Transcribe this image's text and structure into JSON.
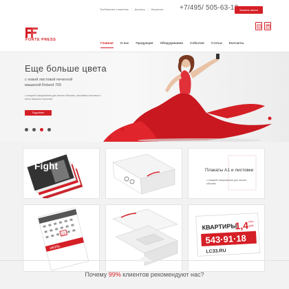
{
  "topbar": {
    "links": [
      "Требования к макетам",
      "Договор",
      "Вакансии"
    ],
    "phone": "+7/495/ 505-63-13",
    "callback_label": "Заказать звонок"
  },
  "brand": {
    "name": "FORTE PRESS",
    "accent_color": "#d51f26"
  },
  "header_icons": [
    "document-icon",
    "calculator-icon"
  ],
  "nav": {
    "items": [
      "Главная",
      "О нас",
      "Продукция",
      "Оборудование",
      "События",
      "Статьи",
      "Контакты"
    ],
    "active_index": 0
  },
  "hero": {
    "title": "Еще больше цвета",
    "subtitle": "с новой листовой печатной машиной Roland 705",
    "small_text": "с секцией лакирования для печати обложек, рекламных вставок и всего высшего качества",
    "button_label": "Подробнее",
    "slide_count": 4,
    "active_slide": 2
  },
  "tiles": {
    "featured_title": "Плакаты А1 и листовки",
    "featured_desc": "с секцией лакирования для печати обложек",
    "poster_headline": "КВАРТИРЫ",
    "poster_price": "1,4",
    "poster_price_unit_1": "млн.",
    "poster_price_unit_2": "руб.",
    "poster_phone": "543·91·18",
    "poster_site": "LC33.RU",
    "calendar_month": "ИЮЛЬ",
    "calendar_day": "23",
    "magazine_title": "Fight"
  },
  "bottom": {
    "question_before": "Почему ",
    "question_accent": "99%",
    "question_after": " клиентов рекомендуют нас?"
  }
}
